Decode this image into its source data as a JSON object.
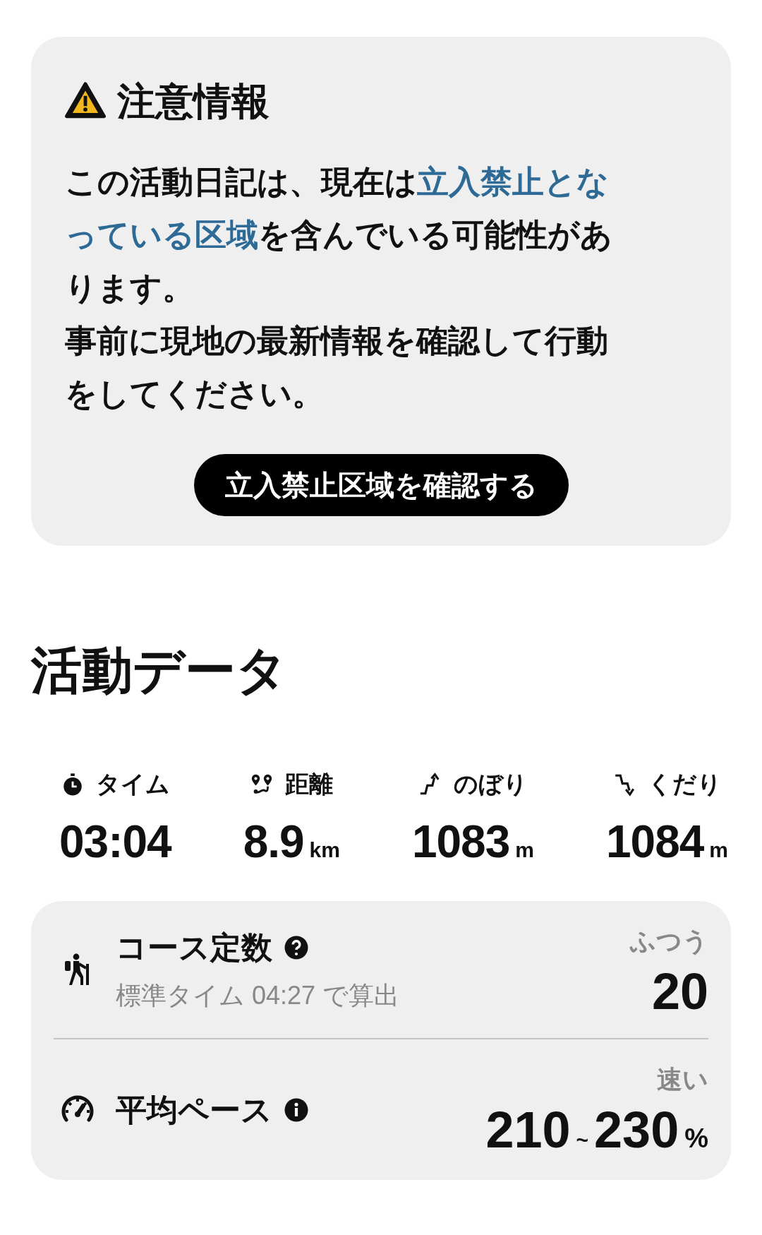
{
  "notice": {
    "title": "注意情報",
    "paragraphs": [
      [
        {
          "text": "この活動日記は、現在は",
          "link": false
        },
        {
          "text": "立入禁止とな",
          "link": true
        },
        {
          "text": "っている区域",
          "link": true
        },
        {
          "text": "を含んでいる可能性があります。",
          "link": false
        }
      ],
      [
        {
          "text": "事前に現地の最新情報を確認して行動をしてください。",
          "link": false
        }
      ]
    ],
    "button": "立入禁止区域を確認する"
  },
  "section_title": "活動データ",
  "stats": [
    {
      "kind": "time",
      "label": "タイム",
      "value": "03:04"
    },
    {
      "kind": "distance",
      "label": "距離",
      "value": "8.9",
      "unit": "km"
    },
    {
      "kind": "ascent",
      "label": "のぼり",
      "value": "1083",
      "unit": "m"
    },
    {
      "kind": "descent",
      "label": "くだり",
      "value": "1084",
      "unit": "m"
    }
  ],
  "metrics": [
    {
      "kind": "course",
      "title": "コース定数",
      "subtitle": "標準タイム 04:27 で算出",
      "rating": "ふつう",
      "value": [
        {
          "text": "20",
          "kind": "number"
        }
      ]
    },
    {
      "kind": "pace",
      "title": "平均ペース",
      "rating": "速い",
      "value": [
        {
          "text": "210",
          "kind": "number"
        },
        {
          "text": "~",
          "kind": "sep"
        },
        {
          "text": "230",
          "kind": "number"
        },
        {
          "text": "%",
          "kind": "unit"
        }
      ]
    }
  ]
}
